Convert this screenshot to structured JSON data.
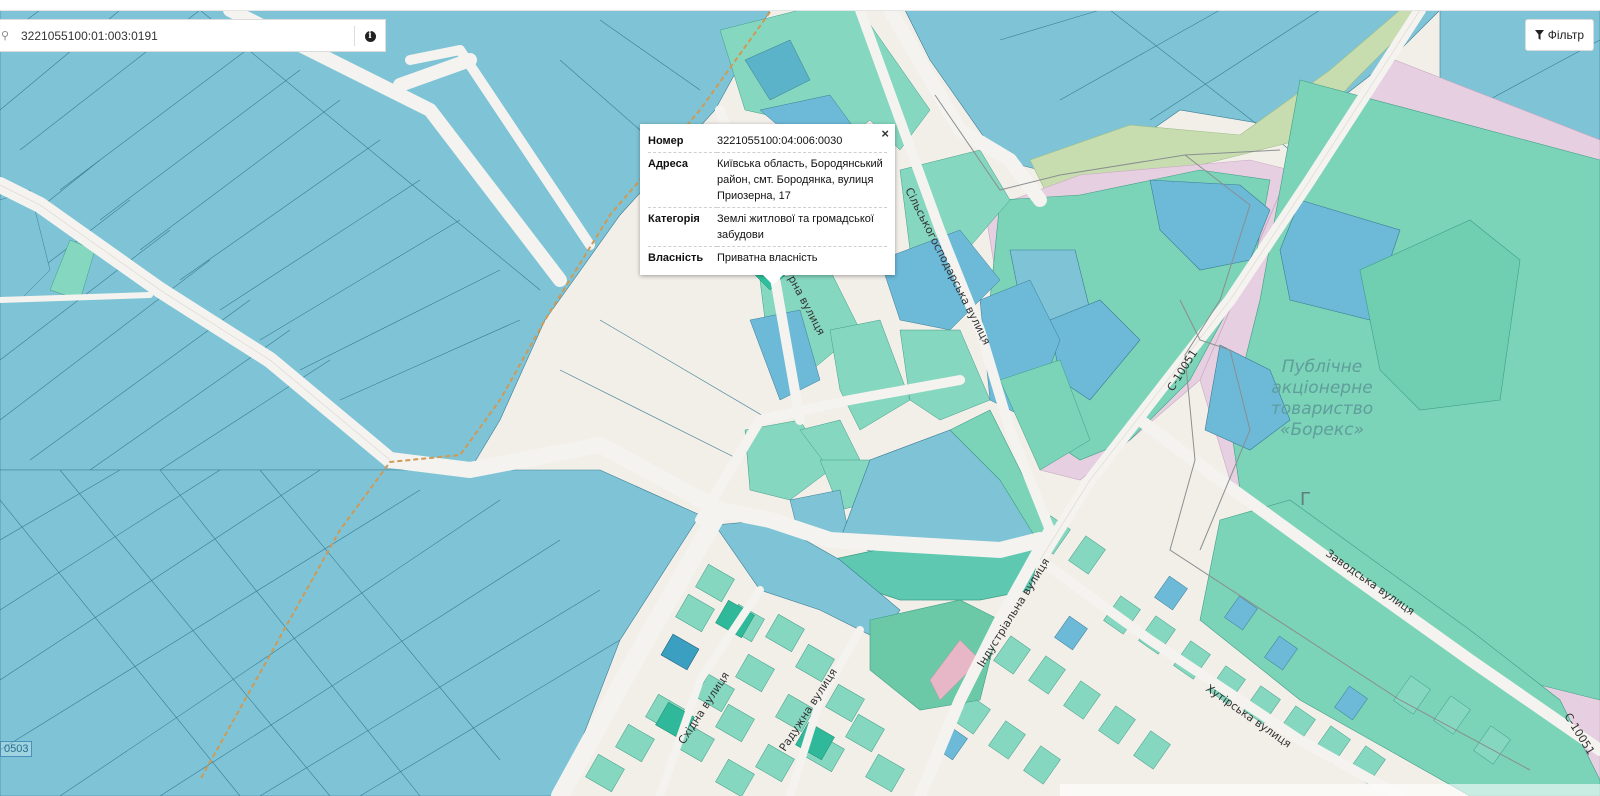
{
  "search": {
    "value": "3221055100:01:003:0191"
  },
  "filter": {
    "label": "Фільтр"
  },
  "popup": {
    "rows": [
      {
        "key": "Номер",
        "value": "3221055100:04:006:0030"
      },
      {
        "key": "Адреса",
        "value": "Київська область, Бородянський район, смт. Бородянка, вулиця Приозерна, 17"
      },
      {
        "key": "Категорія",
        "value": "Землі житлової та громадської забудови"
      },
      {
        "key": "Власність",
        "value": "Приватна власність"
      }
    ],
    "close": "×"
  },
  "map": {
    "streets": [
      "Сільськогосподарська вулиця",
      "рна вулиця",
      "Індустріальна вулиця",
      "Заводська вулиця",
      "Хутірська вулиця",
      "Радужна вулиця",
      "Східна вулиця",
      "С-10051",
      "С-10051"
    ],
    "company_label": [
      "Публічне",
      "акціонерне",
      "товариство",
      "«Борекс»"
    ],
    "symbol": "Г",
    "edge_label": "0503"
  },
  "colors": {
    "agri_parcel": "#7ec4d6",
    "residential_parcel": "#7fdac0",
    "mixed_parcel": "#6cb9d8",
    "industrial": "#7bd3b8",
    "road": "#f5f3ef",
    "pink_zone": "#e6cfe0",
    "rail": "#cf9a56"
  }
}
